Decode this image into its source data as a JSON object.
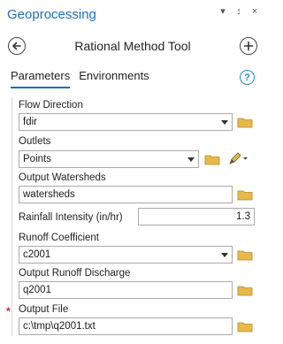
{
  "pane": {
    "title": "Geoprocessing",
    "controls": {
      "menu": "▾",
      "pin": "↕",
      "close": "×"
    }
  },
  "tool": {
    "title": "Rational Method Tool"
  },
  "tabs": [
    {
      "label": "Parameters",
      "active": true
    },
    {
      "label": "Environments",
      "active": false
    }
  ],
  "help": {
    "label": "?"
  },
  "params": {
    "flow_direction": {
      "label": "Flow Direction",
      "value": "fdir"
    },
    "outlets": {
      "label": "Outlets",
      "value": "Points"
    },
    "output_watersheds": {
      "label": "Output Watersheds",
      "value": "watersheds"
    },
    "rainfall_intensity": {
      "label": "Rainfall Intensity (in/hr)",
      "value": "1.3"
    },
    "runoff_coefficient": {
      "label": "Runoff Coefficient",
      "value": "c2001"
    },
    "output_runoff_discharge": {
      "label": "Output Runoff Discharge",
      "value": "q2001"
    },
    "output_file": {
      "label": "Output File",
      "value": "c:\\tmp\\q2001.txt",
      "required_marker": "*"
    }
  },
  "colors": {
    "accent": "#1b6fba",
    "folder": "#e8b84a",
    "required": "#cc2222"
  }
}
